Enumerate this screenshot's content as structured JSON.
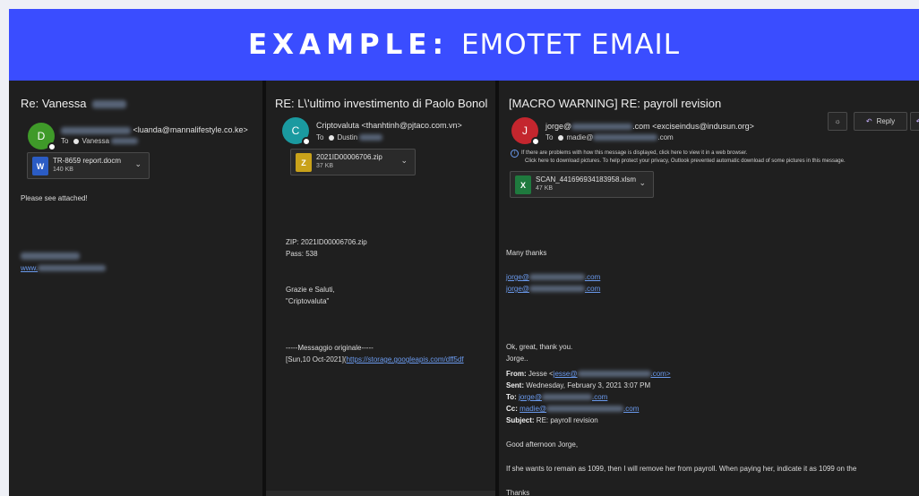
{
  "banner": {
    "prefix": "EXAMPLE:",
    "title": "EMOTET EMAIL"
  },
  "colors": {
    "banner": "#3a4dff",
    "pane": "#1f1f1f",
    "link": "#6b9bef"
  },
  "pane1": {
    "subject": "Re: Vanessa",
    "avatar_letter": "D",
    "avatar_color": "#3f9a29",
    "from_email": "<luanda@mannalifestyle.co.ke>",
    "to_label": "To",
    "to_name": "Vanessa",
    "attachment": {
      "name": "TR-8659 report.docm",
      "size": "140 KB",
      "icon": "word-docm-icon"
    },
    "body": "Please see attached!",
    "sig_link": "www."
  },
  "pane2": {
    "subject": "RE: L\\'ultimo investimento di Paolo Bonol",
    "avatar_letter": "C",
    "avatar_color": "#1a9aa0",
    "from_name": "Criptovaluta <thanhtinh@pjtaco.com.vn>",
    "to_label": "To",
    "to_name": "Dustin",
    "attachment": {
      "name": "2021ID00006706.zip",
      "size": "37 KB",
      "icon": "zip-archive-icon"
    },
    "zip_line": "ZIP: 2021ID00006706.zip",
    "pass_line": "Pass: 538",
    "thanks": "Grazie e Saluti,",
    "signoff": "\"Criptovaluta\"",
    "orig_header": "-----Messaggio originale-----",
    "orig_date": "[Sun,10 Oct-2021](",
    "orig_link": "https://storage.googleapis.com/dff5df"
  },
  "pane3": {
    "subject": "[MACRO WARNING] RE: payroll revision",
    "avatar_letter": "J",
    "avatar_color": "#c4262e",
    "from_prefix": "jorge@",
    "from_suffix": ".com <exciseindus@indusun.org>",
    "to_label": "To",
    "to_name": "madie@",
    "to_suffix": ".com",
    "info_line1": "If there are problems with how this message is displayed, click here to view it in a web browser.",
    "info_line2": "Click here to download pictures. To help protect your privacy, Outlook prevented automatic download of some pictures in this message.",
    "attachment": {
      "name": "SCAN_441696934183958.xlsm",
      "size": "47 KB",
      "icon": "excel-xlsm-icon"
    },
    "reply_label": "Reply",
    "many_thanks": "Many thanks",
    "link1_prefix": "jorge@",
    "link1_suffix": ".com",
    "link2_prefix": "jorge@",
    "link2_suffix": ".com",
    "ok_line": "Ok, great, thank you.",
    "jorge_line": "Jorge..",
    "from_label": "From:",
    "from_value_prefix": "Jesse <",
    "from_value_link": "jesse@",
    "from_value_suffix": ".com>",
    "sent_label": "Sent:",
    "sent_value": "Wednesday, February 3, 2021 3:07 PM",
    "to2_label": "To:",
    "to2_value": "jorge@",
    "to2_suffix": ".com",
    "cc_label": "Cc:",
    "cc_value": "madie@",
    "cc_suffix": ".com",
    "subject_label": "Subject:",
    "subject_value": "RE: payroll revision",
    "greeting": "Good afternoon Jorge,",
    "body_line": "If she wants to remain as 1099, then I will remove her from payroll. When paying her, indicate it as 1099 on the",
    "cut_line": "Thanks"
  }
}
